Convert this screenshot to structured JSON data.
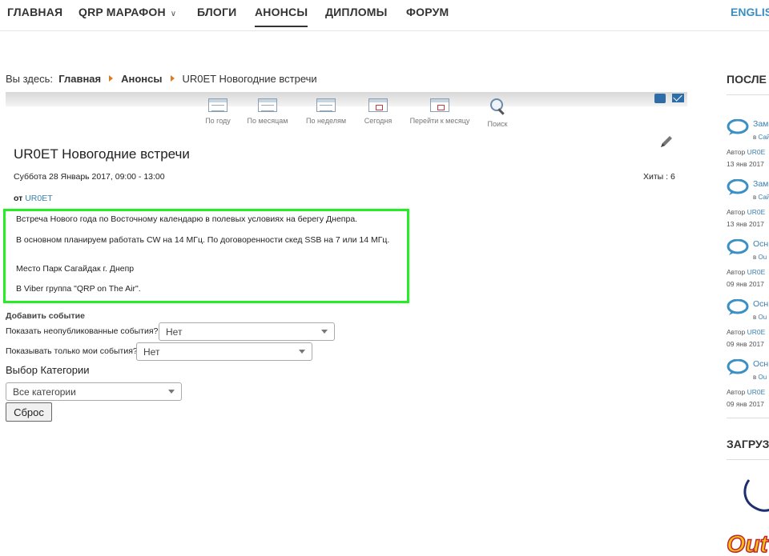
{
  "nav": {
    "items": [
      "ГЛАВНАЯ",
      "QRP МАРАФОН",
      "БЛОГИ",
      "АНОНСЫ",
      "ДИПЛОМЫ",
      "ФОРУМ"
    ],
    "lang": "ENGLIS"
  },
  "breadcrumb": {
    "prefix": "Вы здесь:",
    "home": "Главная",
    "section": "Анонсы",
    "current": "UR0ET Новогодние встречи"
  },
  "toolbar": [
    "По году",
    "По месяцам",
    "По неделям",
    "Сегодня",
    "Перейти к месяцу",
    "Поиск"
  ],
  "event": {
    "title": "UR0ET Новогодние встречи",
    "date": "Суббота 28 Январь 2017, 09:00 - 13:00",
    "hits": "Хиты : 6",
    "author_prefix": "от",
    "author": "UR0ET",
    "description": [
      "Встреча Нового года по Восточному календарю в полевых условиях на берегу Днепра.",
      "В основном планируем работать CW на 14 МГц. По договоренности скед SSB на 7 или 14 МГц.",
      "Место Парк Сагайдак г. Днепр",
      "В Viber группа \"QRP on The Air\"."
    ]
  },
  "filters": {
    "add_event": "Добавить событие",
    "unpublished_label": "Показать неопубликованные события?",
    "unpublished_value": "Нет",
    "mine_label": "Показывать только мои события?",
    "mine_value": "Нет",
    "category_label": "Выбор Категории",
    "category_value": "Все категории",
    "reset": "Сброс"
  },
  "sidebar": {
    "heading1": "ПОСЛЕ",
    "heading2": "ЗАГРУЗ",
    "items": [
      {
        "title": "Зам",
        "in": "в",
        "in_link": "Сай",
        "auth": "Автор",
        "auth_link": "UR0E",
        "date": "13 янв 2017"
      },
      {
        "title": "Зам",
        "in": "в",
        "in_link": "Сай",
        "auth": "Автор",
        "auth_link": "UR0E",
        "date": "13 янв 2017"
      },
      {
        "title": "Осн",
        "in": "в",
        "in_link": "Ou",
        "auth": "Автор",
        "auth_link": "UR0E",
        "date": "09 янв 2017"
      },
      {
        "title": "Осн",
        "in": "в",
        "in_link": "Ou",
        "auth": "Автор",
        "auth_link": "UR0E",
        "date": "09 янв 2017"
      },
      {
        "title": "Осн",
        "in": "в",
        "in_link": "Ou",
        "auth": "Автор",
        "auth_link": "UR0E",
        "date": "09 янв 2017"
      }
    ],
    "logo_text": "Out"
  },
  "colors": {
    "accent": "#3a7fb0",
    "highlight": "#22ee22",
    "breadcrumb_arrow": "#e07b1e"
  }
}
